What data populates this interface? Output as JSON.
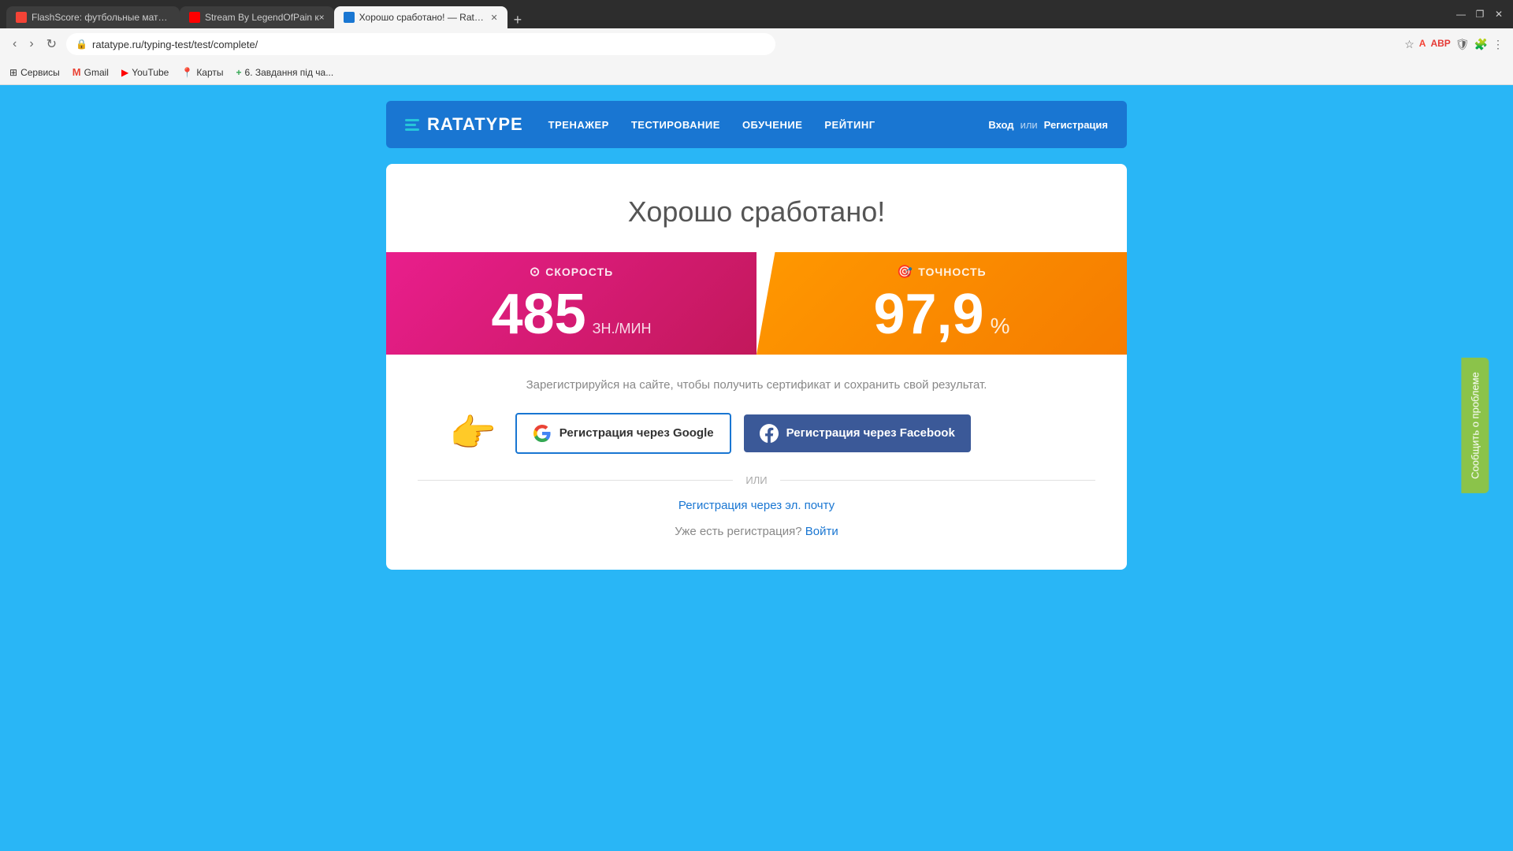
{
  "browser": {
    "tabs": [
      {
        "id": "tab1",
        "favicon_color": "#f44336",
        "label": "FlashScore: футбольные матчи ×",
        "active": false
      },
      {
        "id": "tab2",
        "favicon_color": "#ff0000",
        "label": "Stream By LegendOfPain к×",
        "active": false
      },
      {
        "id": "tab3",
        "favicon_color": "#1976d2",
        "label": "Хорошо сработано! — Ratatype",
        "active": true
      }
    ],
    "new_tab_label": "+",
    "address": "ratatype.ru/typing-test/test/complete/",
    "address_full": "ratatype.ru/typing-test/test/complete/",
    "nav_back": "‹",
    "nav_forward": "›",
    "nav_reload": "↻",
    "window_minimize": "—",
    "window_maximize": "❐",
    "window_close": "✕"
  },
  "bookmarks": [
    {
      "label": "Сервисы",
      "favicon": "grid"
    },
    {
      "label": "Gmail",
      "favicon": "gmail"
    },
    {
      "label": "YouTube",
      "favicon": "youtube"
    },
    {
      "label": "Карты",
      "favicon": "maps"
    },
    {
      "label": "6. Завдання під ча...",
      "favicon": "docs"
    }
  ],
  "nav": {
    "logo": "RATATYPE",
    "links": [
      "ТРЕНАЖЕР",
      "ТЕСТИРОВАНИЕ",
      "ОБУЧЕНИЕ",
      "РЕЙТИНГ"
    ],
    "login": "Вход",
    "or": "или",
    "register": "Регистрация"
  },
  "results": {
    "title": "Хорошо сработано!",
    "speed_label": "СКОРОСТЬ",
    "speed_value": "485",
    "speed_unit": "ЗН./МИН",
    "accuracy_label": "ТОЧНОСТЬ",
    "accuracy_value": "97,9",
    "accuracy_unit": "%"
  },
  "registration": {
    "prompt": "Зарегистрируйся на сайте, чтобы получить сертификат и сохранить свой результат.",
    "google_btn": "Регистрация через Google",
    "facebook_btn": "Регистрация через Facebook",
    "divider": "ИЛИ",
    "email_link": "Регистрация через эл. почту",
    "already_registered": "Уже есть регистрация?",
    "login_link": "Войти"
  },
  "feedback": {
    "label": "Сообщить о проблеме"
  }
}
